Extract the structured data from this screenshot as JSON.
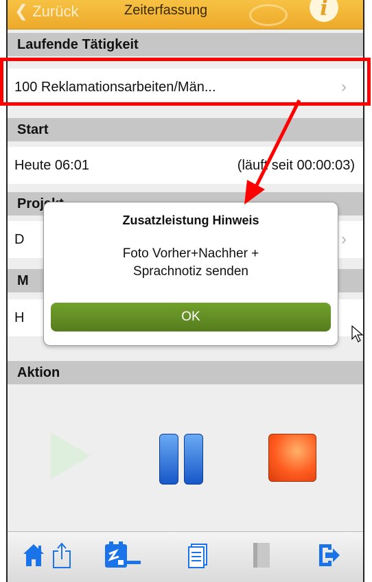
{
  "navbar": {
    "back_label": "Zurück",
    "title": "Zeiterfassung",
    "info_icon": "i"
  },
  "sections": {
    "laufende": {
      "header": "Laufende Tätigkeit",
      "value": "100 Reklamationsarbeiten/Män..."
    },
    "start": {
      "header": "Start",
      "value": "Heute 06:01",
      "status": "(läuft seit 00:00:03)"
    },
    "projekt": {
      "header": "Projekt",
      "value": "D"
    },
    "m": {
      "header": "M",
      "value": "H"
    },
    "aktion": {
      "header": "Aktion"
    }
  },
  "dialog": {
    "title": "Zusatzleistung Hinweis",
    "message_line1": "Foto Vorher+Nachher +",
    "message_line2": "Sprachnotiz senden",
    "ok_label": "OK"
  },
  "toolbar": {
    "icons": [
      "home-icon",
      "share-icon",
      "report-edit-icon",
      "document-icon",
      "notebook-icon",
      "logout-icon"
    ]
  },
  "colors": {
    "navbar": "#f0b030",
    "section_header": "#c6c6c6",
    "ok_button": "#5f8a22",
    "annotation": "#ff0000",
    "icon_blue": "#1a73e8"
  }
}
